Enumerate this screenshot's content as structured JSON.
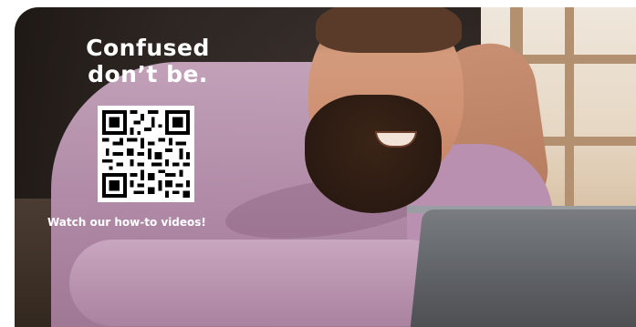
{
  "banner": {
    "headline_line1": "Confused",
    "headline_line2": "don’t be.",
    "caption": "Watch our how-to videos!",
    "qr_icon": "qr-code-icon",
    "photo_subject": "bearded-man-at-laptop",
    "colors": {
      "text": "#ffffff",
      "qr_background": "#ffffff",
      "qr_foreground": "#000000",
      "shirt": "#b28aa8"
    }
  }
}
